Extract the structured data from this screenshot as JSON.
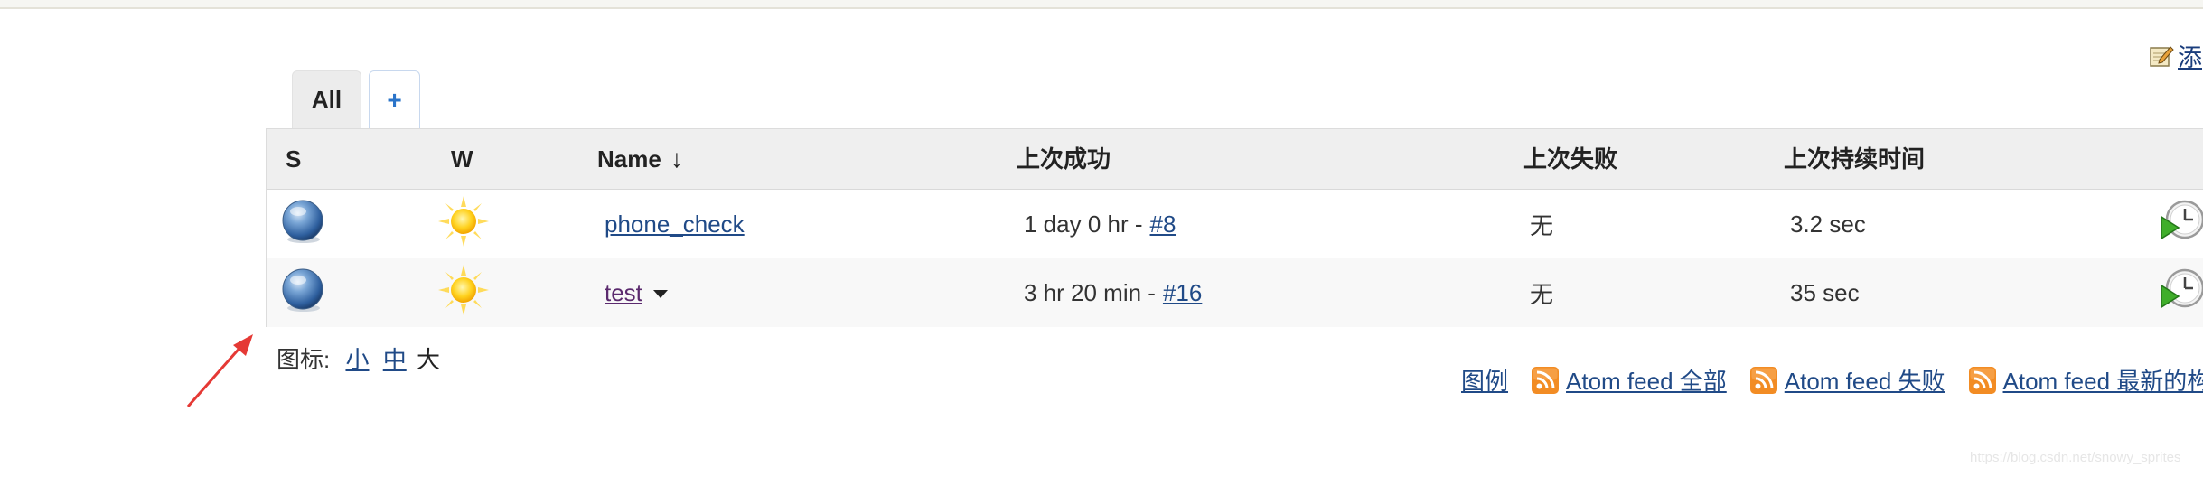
{
  "header": {
    "add_description": "添"
  },
  "tabs": [
    {
      "label": "All",
      "active": true
    },
    {
      "label": "+",
      "active": false
    }
  ],
  "table": {
    "columns": {
      "status": "S",
      "weather": "W",
      "name": "Name",
      "name_sort": "↓",
      "last_success": "上次成功",
      "last_failure": "上次失败",
      "last_duration": "上次持续时间"
    },
    "rows": [
      {
        "status_icon": "blue-ball-icon",
        "weather_icon": "sunny-icon",
        "name": "phone_check",
        "last_success_text": "1 day 0 hr -",
        "last_success_build": "#8",
        "last_failure": "无",
        "last_duration": "3.2 sec",
        "action_icon": "schedule-build-icon"
      },
      {
        "status_icon": "blue-ball-icon",
        "weather_icon": "sunny-icon",
        "name": "test",
        "last_success_text": "3 hr 20 min -",
        "last_success_build": "#16",
        "last_failure": "无",
        "last_duration": "35 sec",
        "action_icon": "schedule-build-icon"
      }
    ]
  },
  "icon_size": {
    "label": "图标:",
    "small": "小",
    "medium": "中",
    "large": "大",
    "current": "large"
  },
  "footer": {
    "legend": "图例",
    "feeds": [
      {
        "label": "Atom feed 全部"
      },
      {
        "label": "Atom feed 失败"
      },
      {
        "label": "Atom feed 最新的构"
      }
    ]
  },
  "watermark": "https://blog.csdn.net/snowy_sprites",
  "colors": {
    "link": "#204a87",
    "visited_link": "#5b2a6e",
    "header_bg": "#efefef",
    "annotation": "#e53935",
    "rss": "#f28c24"
  }
}
